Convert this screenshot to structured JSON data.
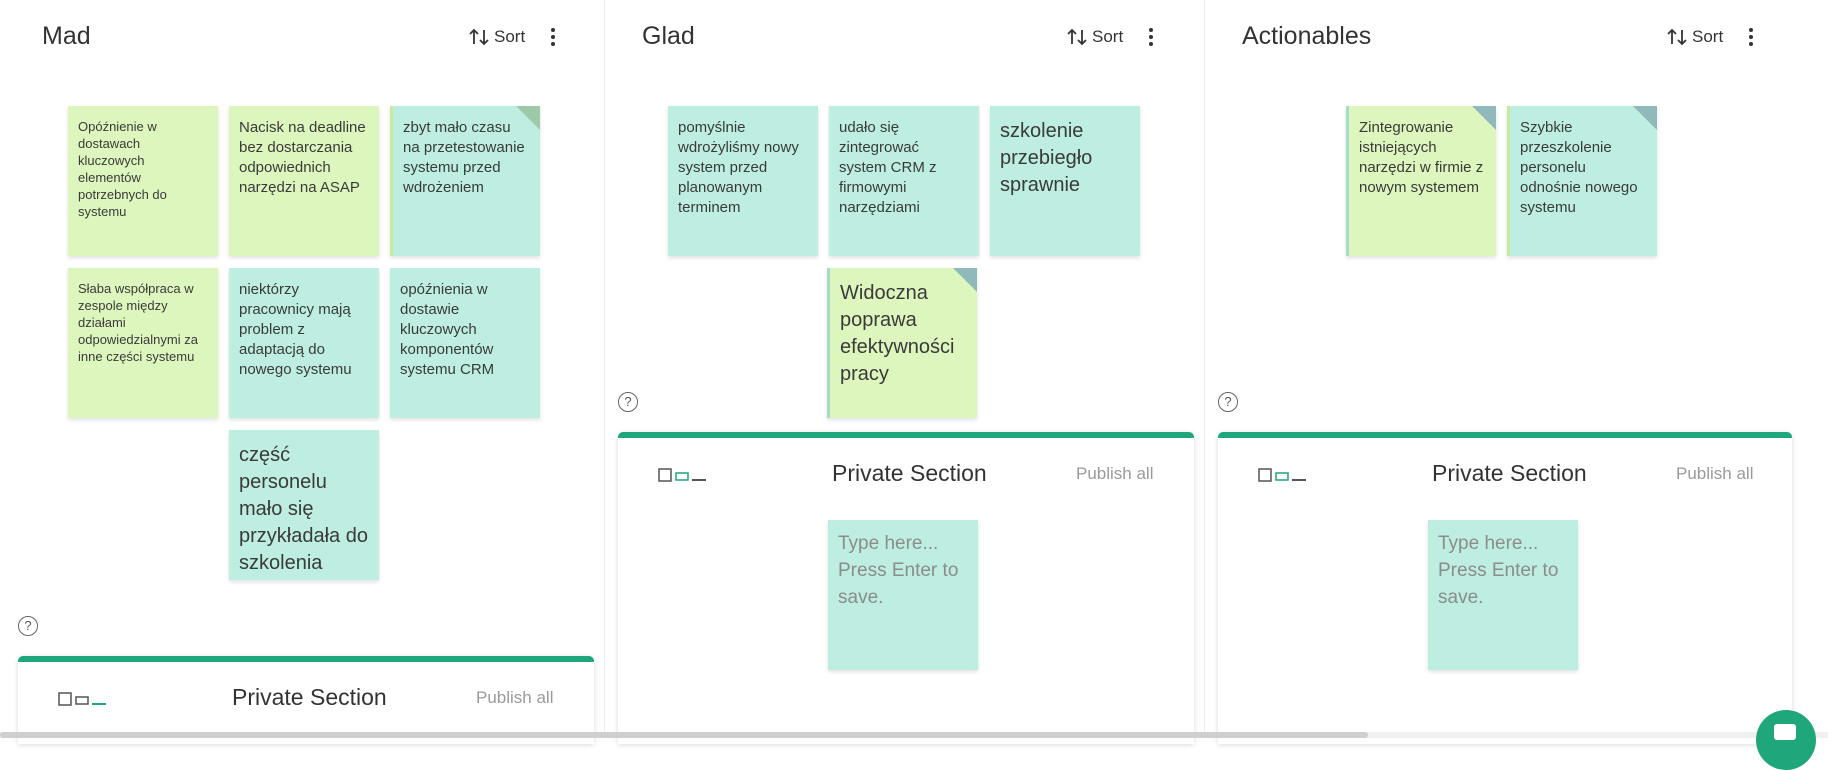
{
  "accent_color": "#1fa67a",
  "note_colors": {
    "teal": "#bdeee1",
    "lime": "#ddf6bd"
  },
  "sort_label": "Sort",
  "columns": [
    {
      "title": "Mad",
      "notes": [
        {
          "text": "Opóźnienie w dostawach kluczowych elementów potrzebnych do systemu",
          "color": "lime"
        },
        {
          "text": "Nacisk na deadline bez dostarczania odpowiednich narzędzi na ASAP",
          "color": "lime"
        },
        {
          "text": "zbyt mało czasu na przetestowanie systemu przed wdrożeniem",
          "color": "teal"
        },
        {
          "text": "Słaba współpraca w zespole między działami odpowiedzialnymi za inne części systemu",
          "color": "lime"
        },
        {
          "text": "niektórzy pracownicy mają problem z adaptacją do nowego systemu",
          "color": "teal"
        },
        {
          "text": "opóźnienia w dostawie kluczowych komponentów systemu CRM",
          "color": "teal"
        },
        {
          "text": "część personelu mało się przykładała do szkolenia",
          "color": "teal"
        }
      ],
      "private": {
        "title": "Private Section",
        "publish_label": "Publish all"
      }
    },
    {
      "title": "Glad",
      "notes": [
        {
          "text": "pomyślnie wdrożyliśmy nowy system przed planowanym terminem",
          "color": "teal"
        },
        {
          "text": "udało się zintegrować system CRM z firmowymi narzędziami",
          "color": "teal"
        },
        {
          "text": "szkolenie przebiegło sprawnie",
          "color": "teal"
        },
        {
          "text": "Widoczna poprawa efektywności pracy",
          "color": "lime"
        }
      ],
      "private": {
        "title": "Private Section",
        "publish_label": "Publish all",
        "input_placeholder": "Type here... Press Enter to save."
      }
    },
    {
      "title": "Actionables",
      "notes": [
        {
          "text": "Zintegrowanie istniejących narzędzi w firmie z nowym systemem",
          "color": "lime"
        },
        {
          "text": "Szybkie przeszkolenie personelu odnośnie nowego systemu",
          "color": "teal"
        }
      ],
      "private": {
        "title": "Private Section",
        "publish_label": "Publish all",
        "input_placeholder": "Type here... Press Enter to save."
      }
    }
  ],
  "icons": {
    "sort": "sort-arrows-icon",
    "menu": "kebab-menu-icon",
    "help": "help-circle-icon",
    "private_section": "private-section-icon",
    "chat": "chat-icon"
  },
  "help_glyph": "?"
}
